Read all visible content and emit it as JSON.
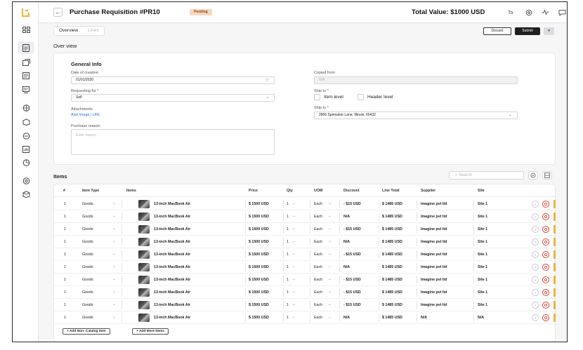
{
  "header": {
    "title": "Purchase Requisition #PR10",
    "status": "Pending",
    "total": "Total Value: $1000 USD"
  },
  "tabs": [
    "Overview",
    "Lines"
  ],
  "actions": {
    "discard": "Discard",
    "submit": "Submit",
    "more": "▾"
  },
  "section_title": "Over view",
  "general_info": {
    "title": "General Info",
    "date_label": "Date of creation",
    "date_value": "01/01/2020",
    "requesting_label": "Requesting for *",
    "requesting_value": "Self",
    "attachments_label": "Attachments",
    "attachments_link": "Add Image | URL",
    "reason_label": "Purchase reason",
    "reason_placeholder": "Enter reason",
    "copied_label": "Copied from",
    "copied_value": "N/A",
    "ship_level_label": "Ship to *",
    "item_level": "Item level",
    "header_level": "Header level",
    "ship_addr_label": "Ship to *",
    "ship_addr_value": "2806 Spinnaker Lane, Illinois, 60432"
  },
  "items": {
    "title": "Items",
    "search_placeholder": "Search",
    "columns": [
      "#",
      "Item Type",
      "Items",
      "Price",
      "Qty",
      "UOM",
      "Discount",
      "Line Total",
      "Supplier",
      "Site"
    ],
    "rows": [
      {
        "n": "1",
        "type": "Goods",
        "item": "13-inch MacBook Air",
        "price": "$ 1500 USD",
        "qty": "1",
        "uom": "Each",
        "discount": "- $15 USD",
        "total": "$ 1485 USD",
        "supplier": "Imagine pvt ltd",
        "site": "Site 1"
      },
      {
        "n": "1",
        "type": "Goods",
        "item": "13-inch MacBook Air",
        "price": "$ 1500 USD",
        "qty": "1",
        "uom": "Each",
        "discount": "N/A",
        "total": "$ 1485 USD",
        "supplier": "Imagine pvt ltd",
        "site": "Site 1"
      },
      {
        "n": "1",
        "type": "Goods",
        "item": "13-inch MacBook Air",
        "price": "$ 1500 USD",
        "qty": "1",
        "uom": "Each",
        "discount": "- $15 USD",
        "total": "$ 1485 USD",
        "supplier": "Imagine pvt ltd",
        "site": "Site 1"
      },
      {
        "n": "1",
        "type": "Goods",
        "item": "13-inch MacBook Air",
        "price": "$ 1500 USD",
        "qty": "1",
        "uom": "Each",
        "discount": "N/A",
        "total": "$ 1485 USD",
        "supplier": "Imagine pvt ltd",
        "site": "Site 1"
      },
      {
        "n": "1",
        "type": "Goods",
        "item": "13-inch MacBook Air",
        "price": "$ 1500 USD",
        "qty": "1",
        "uom": "Each",
        "discount": "- $15 USD",
        "total": "$ 1485 USD",
        "supplier": "Imagine pvt ltd",
        "site": "Site 1"
      },
      {
        "n": "1",
        "type": "Goods",
        "item": "13-inch MacBook Air",
        "price": "$ 1500 USD",
        "qty": "1",
        "uom": "Each",
        "discount": "N/A",
        "total": "$ 1485 USD",
        "supplier": "Imagine pvt ltd",
        "site": "Site 1"
      },
      {
        "n": "1",
        "type": "Goods",
        "item": "13-inch MacBook Air",
        "price": "$ 1500 USD",
        "qty": "1",
        "uom": "Each",
        "discount": "- $15 USD",
        "total": "$ 1485 USD",
        "supplier": "Imagine pvt ltd",
        "site": "Site 1"
      },
      {
        "n": "1",
        "type": "Goods",
        "item": "13-inch MacBook Air",
        "price": "$ 1500 USD",
        "qty": "1",
        "uom": "Each",
        "discount": "- $15 USD",
        "total": "$ 1485 USD",
        "supplier": "Imagine pvt ltd",
        "site": "Site 1"
      },
      {
        "n": "1",
        "type": "Goods",
        "item": "13-inch MacBook Air",
        "price": "$ 1500 USD",
        "qty": "1",
        "uom": "Each",
        "discount": "- $15 USD",
        "total": "$ 1485 USD",
        "supplier": "Imagine pvt ltd",
        "site": "Site 1"
      },
      {
        "n": "1",
        "type": "Goods",
        "item": "13-inch MacBook Air",
        "price": "$ 1500 USD",
        "qty": "1",
        "uom": "Each",
        "discount": "N/A",
        "total": "$ 1485 USD",
        "supplier": "N/A",
        "site": "N/A"
      }
    ],
    "add_non_catalog": "+ Add Non- Catalog Item",
    "add_more": "+ Add More Items"
  },
  "colors": {
    "accent": "#f0b43a",
    "badge_bg": "#f7d7bd",
    "link": "#2f6fd6",
    "danger": "#e0413b"
  }
}
